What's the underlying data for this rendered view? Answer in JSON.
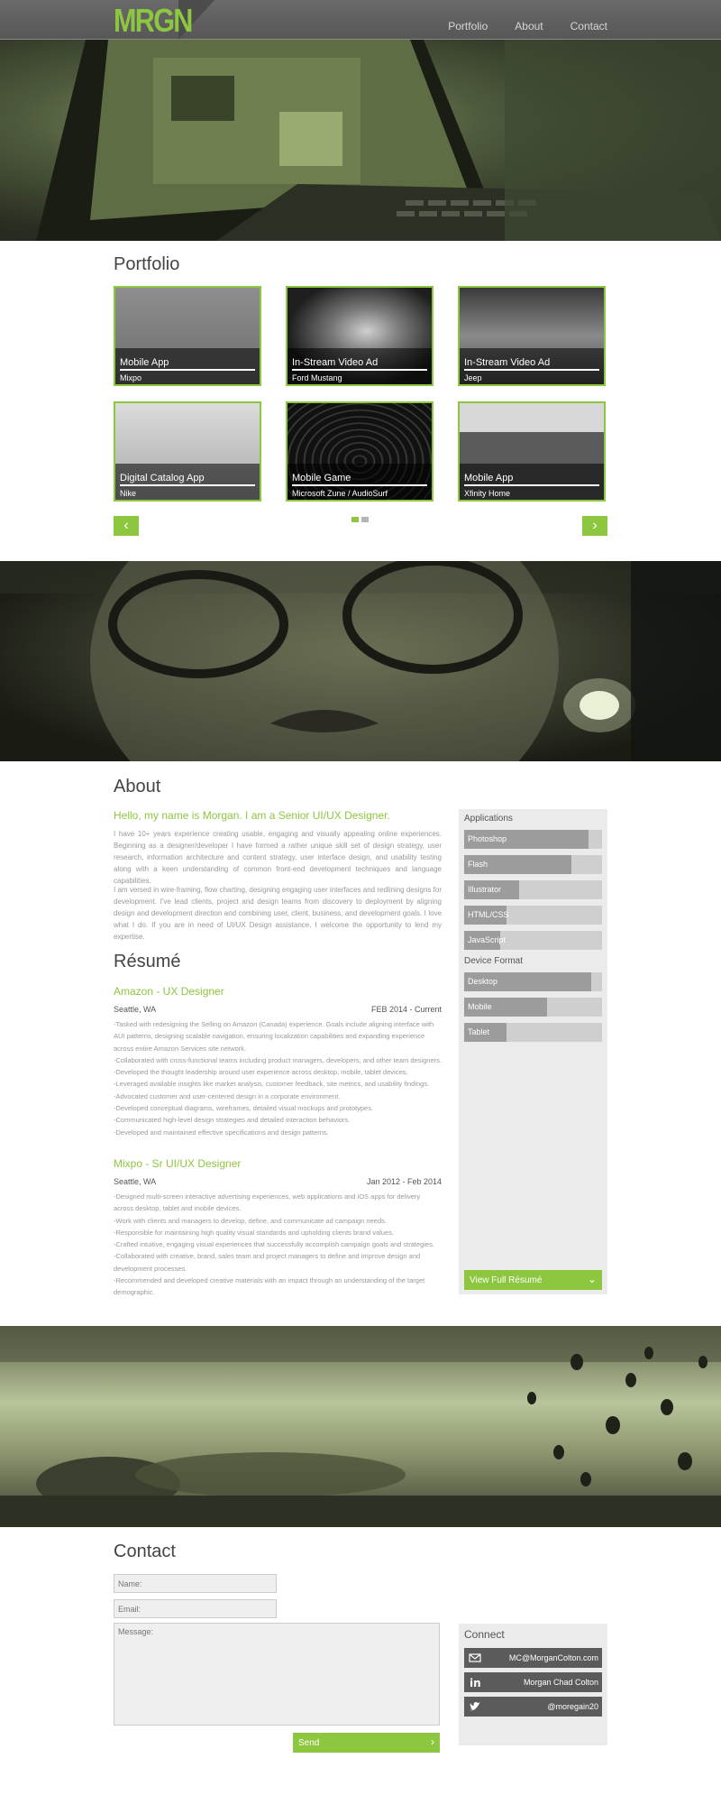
{
  "header": {
    "logo": "MRGN",
    "nav": [
      "Portfolio",
      "About",
      "Contact"
    ]
  },
  "portfolio": {
    "title": "Portfolio",
    "items": [
      {
        "title": "Mobile App",
        "client": "Mixpo"
      },
      {
        "title": "In-Stream Video Ad",
        "client": "Ford Mustang"
      },
      {
        "title": "In-Stream Video Ad",
        "client": "Jeep"
      },
      {
        "title": "Digital Catalog App",
        "client": "Nike"
      },
      {
        "title": "Mobile Game",
        "client": "Microsoft Zune / AudioSurf"
      },
      {
        "title": "Mobile App",
        "client": "Xfinity Home"
      }
    ],
    "prev_icon": "chevron-left-icon",
    "next_icon": "chevron-right-icon",
    "pager": {
      "total": 2,
      "active": 1
    }
  },
  "about": {
    "title": "About",
    "headline": "Hello, my name is Morgan. I am a Senior UI/UX Designer.",
    "paragraph1": "I have 10+ years experience creating usable, engaging and visually appealing online experiences. Beginning as a designer/developer I have formed a rather unique skill set of design strategy, user research, information architecture and content strategy, user interface design, and usability testing along with a keen understanding of common front-end development techniques and language capabilities.",
    "paragraph2": "I am versed in wire-framing, flow charting, designing engaging user interfaces and redlining designs for development. I've lead clients, project and design teams from discovery to deployment by aligning design and development direction and combining user, client, business, and development goals. I love what I do. If you are in need of UI/UX Design assistance, I welcome the opportunity to lend my expertise."
  },
  "resume": {
    "title": "Résumé",
    "jobs": [
      {
        "title": "Amazon - UX Designer",
        "location": "Seattle, WA",
        "date": "FEB 2014 - Current",
        "bullets": [
          "-Tasked with redesigning the Selling on Amazon (Canada) experience. Goals include aligning interface with AUI patterns, designing scalable navigation, ensuring localization capabilities and expanding experience across entire Amazon Services site network.",
          "-Collaborated with cross-functional teams including product managers, developers, and other team designers.",
          "-Developed the thought leadership around user experience across desktop, mobile, tablet devices.",
          "-Leveraged available insights like market analysis, customer feedback, site metrics, and usability findings.",
          "-Advocated customer and user-centered design in a corporate environment.",
          "-Developed conceptual diagrams, wireframes, detailed visual mockups and prototypes.",
          "-Communicated high-level design strategies and detailed interaction behaviors.",
          "-Developed and maintained effective specifications and design patterns."
        ]
      },
      {
        "title": "Mixpo - Sr UI/UX Designer",
        "location": "Seattle, WA",
        "date": "Jan 2012 - Feb 2014",
        "bullets": [
          "-Designed multi-screen interactive advertising experiences, web applications and iOS apps for delivery across desktop, tablet and mobile devices.",
          "-Work with clients and managers to develop, define, and communicate ad campaign needs.",
          "-Responsible for maintaining high quality visual standards and upholding clients brand values.",
          "-Crafted intuitive, engaging visual experiences that successfully accomplish campaign goals and strategies.",
          "-Collaborated with creative, brand, sales team and project managers to define and improve design and development processes.",
          "-Recommended and developed creative materials with an impact through an understanding of the target demographic."
        ]
      }
    ]
  },
  "skills": {
    "applications_label": "Applications",
    "applications": [
      {
        "name": "Photoshop",
        "level": 0.9
      },
      {
        "name": "Flash",
        "level": 0.78
      },
      {
        "name": "Illustrator",
        "level": 0.4
      },
      {
        "name": "HTML/CSS",
        "level": 0.31
      },
      {
        "name": "JavaScript",
        "level": 0.26
      }
    ],
    "device_label": "Device Format",
    "devices": [
      {
        "name": "Desktop",
        "level": 0.92
      },
      {
        "name": "Mobile",
        "level": 0.6
      },
      {
        "name": "Tablet",
        "level": 0.31
      }
    ],
    "view_button": "View Full Résumé"
  },
  "contact": {
    "title": "Contact",
    "name_placeholder": "Name:",
    "email_placeholder": "Email:",
    "message_placeholder": "Message:",
    "send_label": "Send",
    "connect": {
      "title": "Connect",
      "items": [
        {
          "icon": "mail-icon",
          "label": "MC@MorganColton.com"
        },
        {
          "icon": "linkedin-icon",
          "label": "Morgan Chad Colton"
        },
        {
          "icon": "twitter-icon",
          "label": "@moregain20"
        }
      ]
    }
  },
  "colors": {
    "accent": "#8dc63f",
    "panel": "#ebebeb",
    "header": "#5c5c5c"
  }
}
